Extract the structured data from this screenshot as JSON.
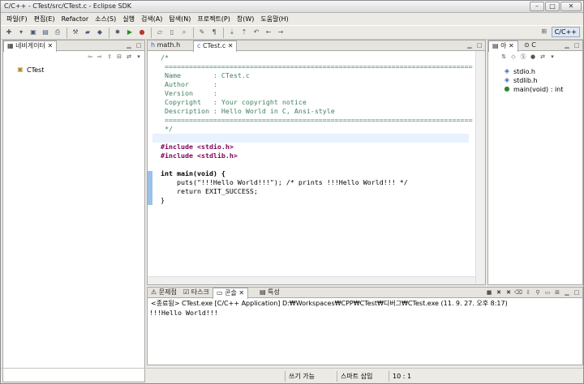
{
  "window": {
    "title": "C/C++ - CTest/src/CTest.c - Eclipse SDK"
  },
  "menu": [
    "파일(F)",
    "편집(E)",
    "Refactor",
    "소스(S)",
    "실행",
    "검색(A)",
    "탐색(N)",
    "프로젝트(P)",
    "창(W)",
    "도움말(H)"
  ],
  "perspective": {
    "label": "C/C++"
  },
  "navigator": {
    "tab": "네비게이터",
    "items": [
      {
        "label": "CTest"
      }
    ]
  },
  "editor": {
    "tabs": [
      {
        "label": "math.h"
      },
      {
        "label": "CTest.c"
      }
    ],
    "lines": [
      "/*",
      " ============================================================================",
      " Name        : CTest.c",
      " Author      :",
      " Version     :",
      " Copyright   : Your copyright notice",
      " Description : Hello World in C, Ansi-style",
      " ============================================================================",
      " */",
      "",
      "#include <stdio.h>",
      "#include <stdlib.h>",
      "",
      "int main(void) {",
      "    puts(\"!!!Hello World!!!\"); /* prints !!!Hello World!!! */",
      "    return EXIT_SUCCESS;",
      "}"
    ]
  },
  "outline": {
    "tab": "아",
    "tab2": "C",
    "items": [
      {
        "label": "stdio.h"
      },
      {
        "label": "stdlib.h"
      },
      {
        "label": "main(void) : int"
      }
    ]
  },
  "console": {
    "tabs": [
      {
        "label": "문제점"
      },
      {
        "label": "타스크"
      },
      {
        "label": "콘솔"
      },
      {
        "label": "특성"
      }
    ],
    "header": "<종료됨> CTest.exe [C/C++ Application] D:₩Workspaces₩CPP₩CTest₩디버그₩CTest.exe (11. 9. 27. 오후 8:17)",
    "output": "!!!Hello World!!!"
  },
  "status": {
    "writable": "쓰기 가능",
    "insert": "스마트 삽입",
    "position": "10 : 1"
  }
}
